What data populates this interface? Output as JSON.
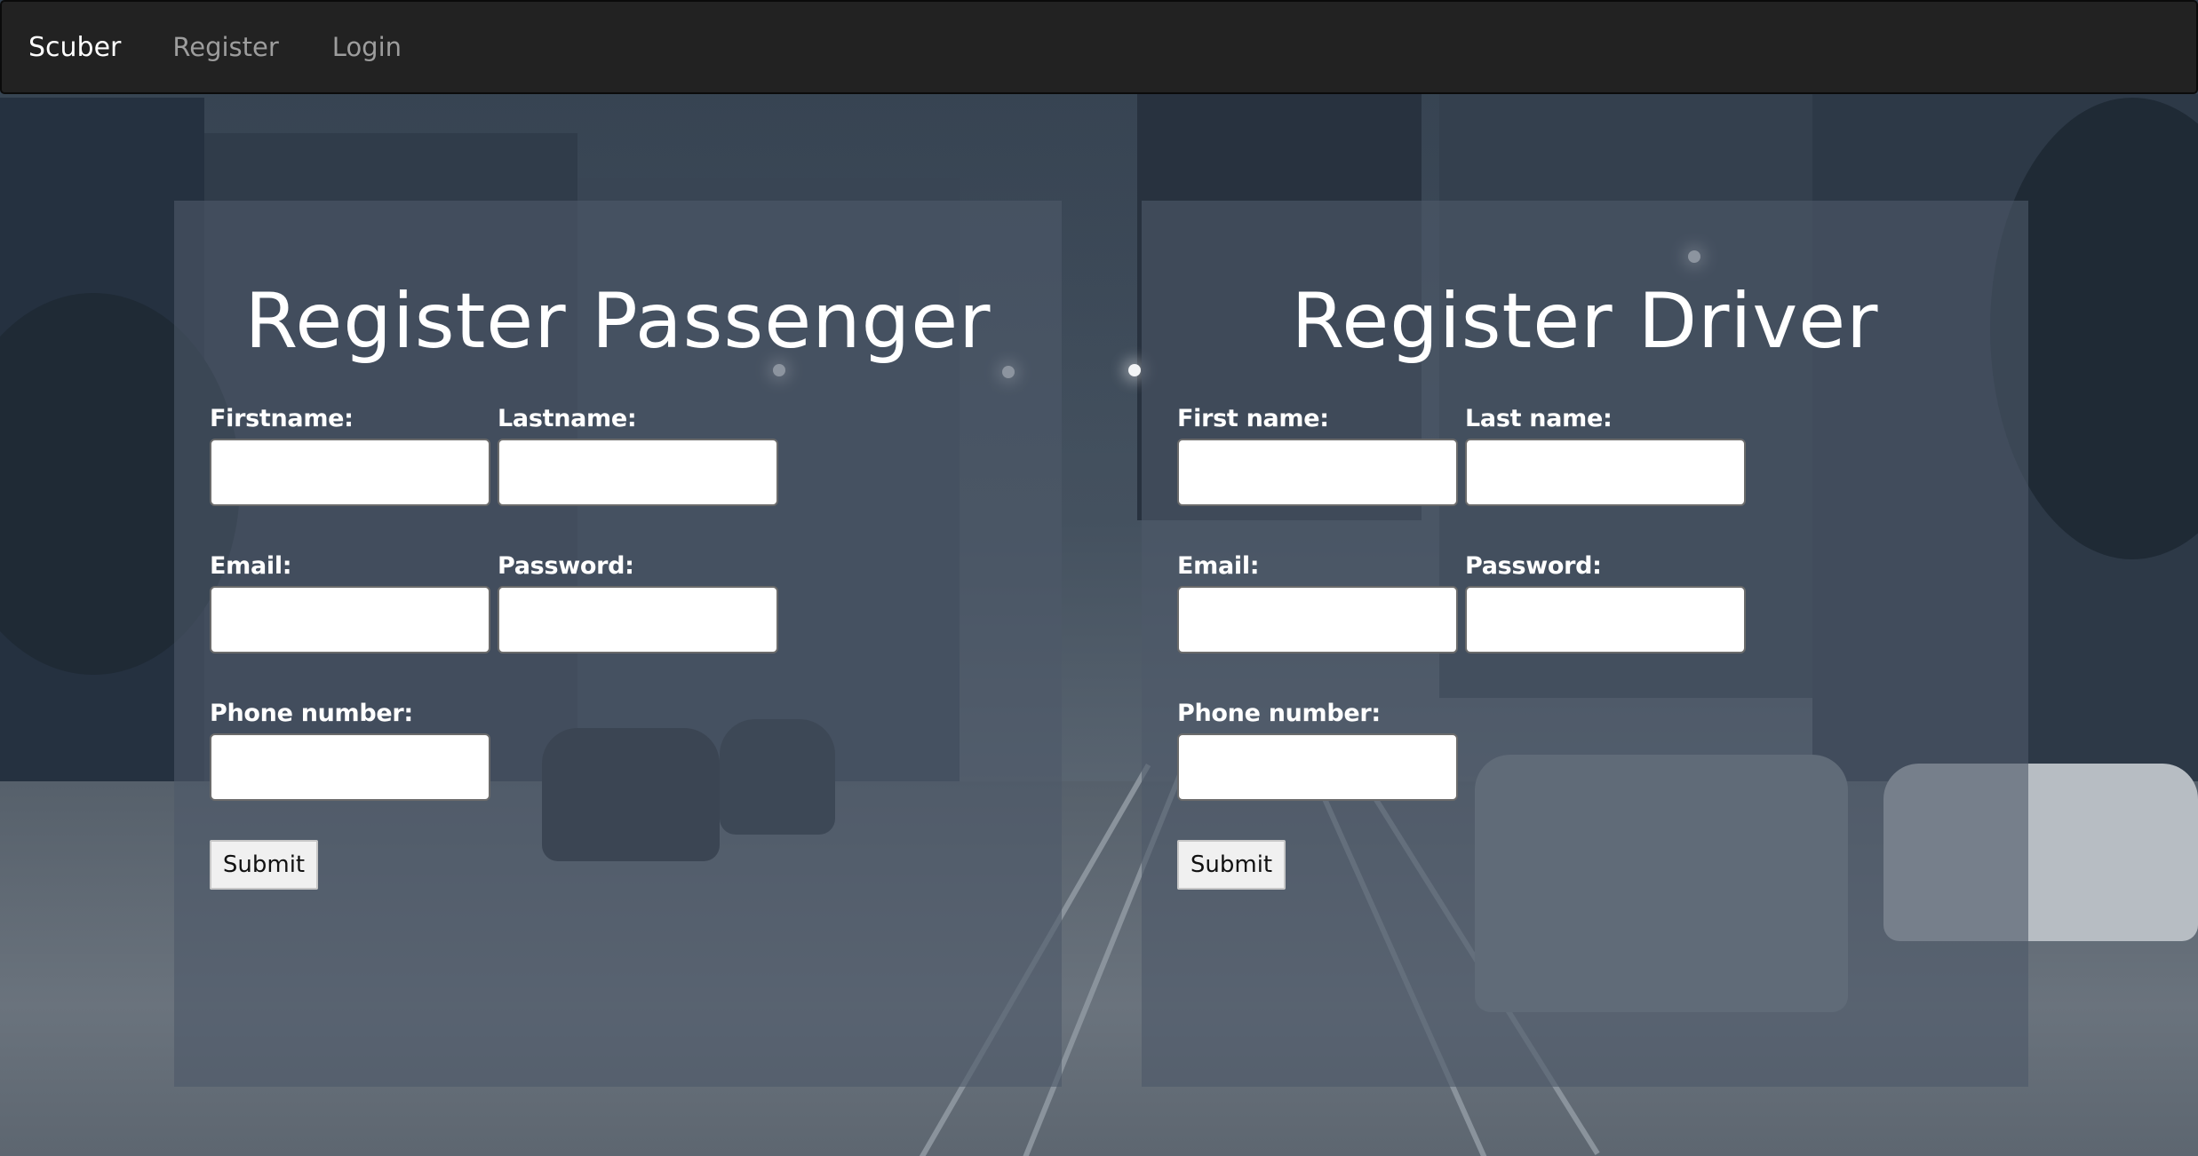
{
  "navbar": {
    "brand": "Scuber",
    "links": [
      "Register",
      "Login"
    ]
  },
  "passenger_form": {
    "title": "Register Passenger",
    "firstname_label": "Firstname:",
    "lastname_label": "Lastname:",
    "email_label": "Email:",
    "password_label": "Password:",
    "phone_label": "Phone number:",
    "submit_label": "Submit",
    "values": {
      "firstname": "",
      "lastname": "",
      "email": "",
      "password": "",
      "phone": ""
    }
  },
  "driver_form": {
    "title": "Register Driver",
    "firstname_label": "First name:",
    "lastname_label": "Last name:",
    "email_label": "Email:",
    "password_label": "Password:",
    "phone_label": "Phone number:",
    "submit_label": "Submit",
    "values": {
      "firstname": "",
      "lastname": "",
      "email": "",
      "password": "",
      "phone": ""
    }
  },
  "colors": {
    "navbar_bg": "#222222",
    "nav_link": "#9d9d9d",
    "panel_bg": "rgba(77,89,105,0.62)",
    "text": "#ffffff"
  },
  "background_image": "night city street with cable car tracks and cars"
}
